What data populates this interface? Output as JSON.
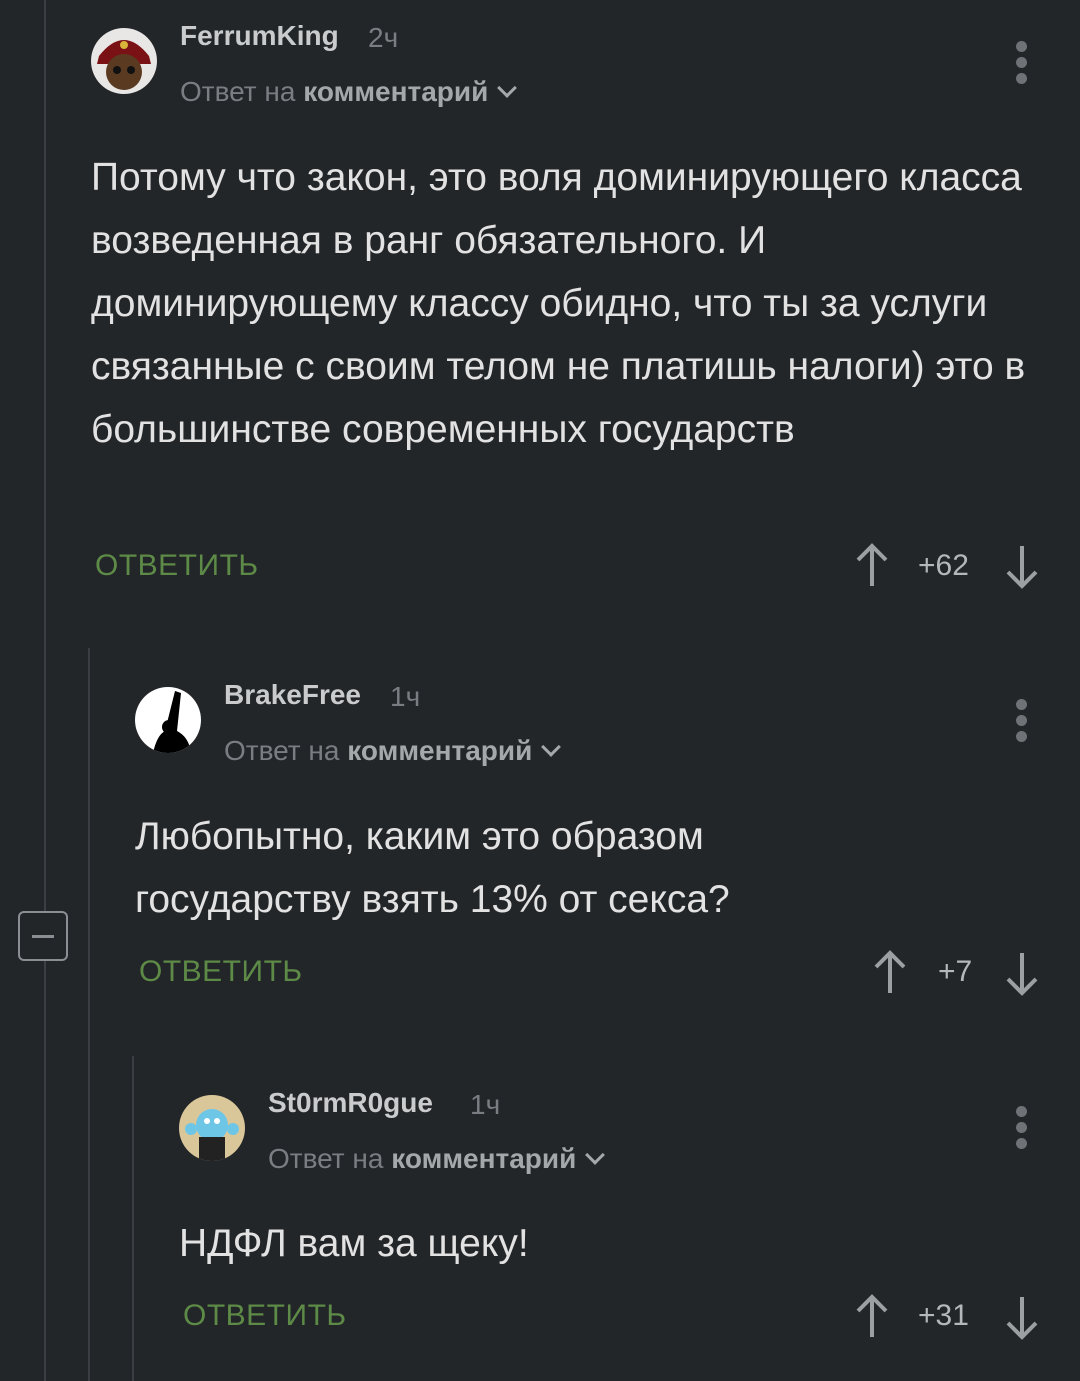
{
  "comments": [
    {
      "username": "FerrumKing",
      "time": "2ч",
      "reply_prefix": "Ответ на",
      "reply_target": "комментарий",
      "text": "Потому что закон, это воля доминирующего класса возведенная в ранг обязательного. И доминирующему классу обидно, что ты за услуги связанные с своим телом не платишь налоги) это в большинстве современных государств",
      "reply_label": "ОТВЕТИТЬ",
      "score": "+62"
    },
    {
      "username": "BrakeFree",
      "time": "1ч",
      "reply_prefix": "Ответ на",
      "reply_target": "комментарий",
      "text": "Любопытно, каким это образом государству взять 13% от секса?",
      "reply_label": "ОТВЕТИТЬ",
      "score": "+7"
    },
    {
      "username": "St0rmR0gue",
      "time": "1ч",
      "reply_prefix": "Ответ на",
      "reply_target": "комментарий",
      "text": "НДФЛ вам за щеку!",
      "reply_label": "ОТВЕТИТЬ",
      "score": "+31"
    }
  ],
  "colors": {
    "background": "#232629",
    "reply_button": "#5d8a46",
    "thread_line": "#3b3f43"
  },
  "icons": [
    "more-vertical-icon",
    "arrow-up-icon",
    "arrow-down-icon",
    "collapse-minus-icon",
    "chevron-down-icon"
  ]
}
